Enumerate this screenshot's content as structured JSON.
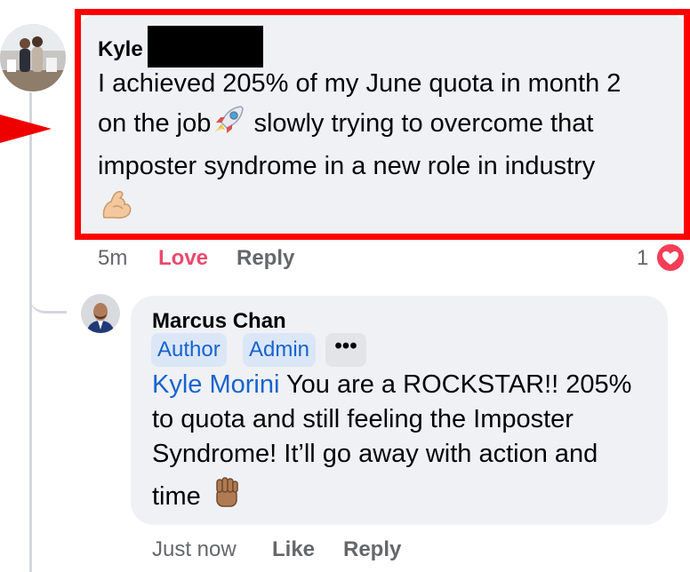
{
  "comment": {
    "author": "Kyle",
    "text_line1": "I achieved 205% of my June quota in month 2",
    "text_line2a": "on the job",
    "text_line2b": " slowly trying to overcome that",
    "text_line3": "imposter syndrome in a new role in industry",
    "emoji_inline": "rocket-emoji",
    "emoji_end": "flexed-biceps-emoji",
    "time": "5m",
    "love_label": "Love",
    "reply_label": "Reply",
    "reaction_count": "1",
    "reaction_icon": "heart-icon"
  },
  "reply": {
    "author": "Marcus Chan",
    "badges": [
      "Author",
      "Admin"
    ],
    "more_label": "•••",
    "mention": "Kyle Morini",
    "text_line1": " You are a ROCKSTAR!! 205%",
    "text_line2": "to quota and still feeling the Imposter",
    "text_line3": "Syndrome! It’ll go away with action and",
    "text_line4": "time",
    "emoji_end": "raised-fist-emoji",
    "time": "Just now",
    "like_label": "Like",
    "reply_label": "Reply"
  },
  "colors": {
    "highlight": "#ff0000",
    "bubble": "#eff1f5",
    "love": "#e84a6e",
    "mention": "#1763cf",
    "meta": "#65676b"
  }
}
